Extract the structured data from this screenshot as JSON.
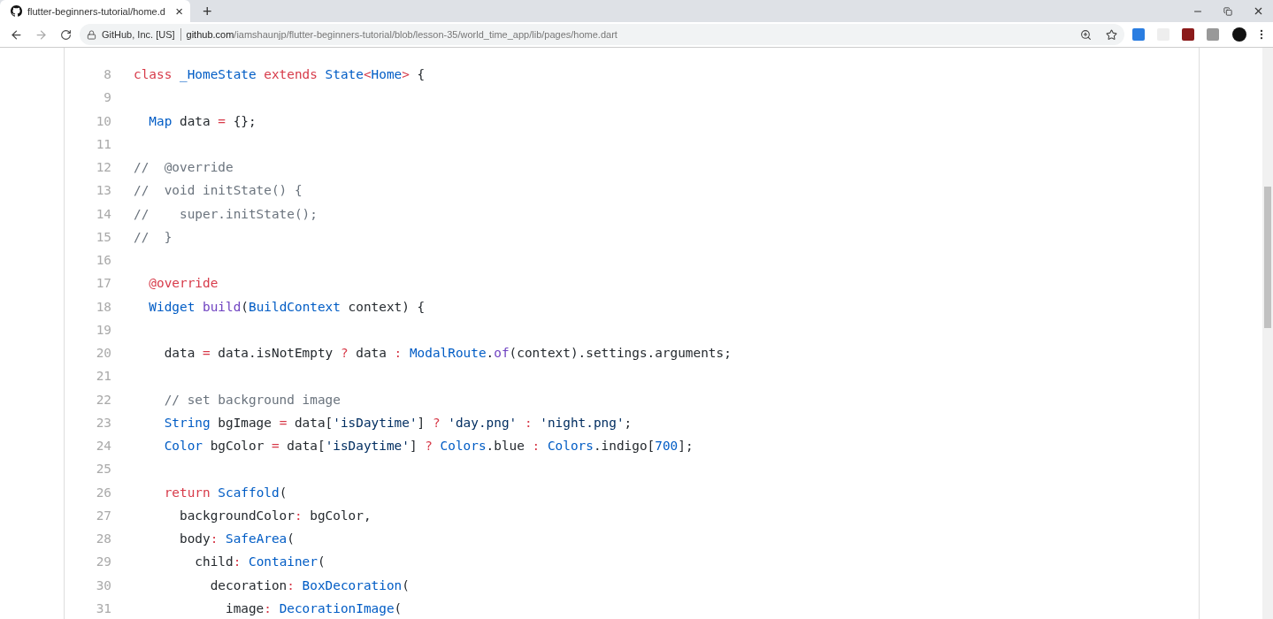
{
  "tab": {
    "title": "flutter-beginners-tutorial/home.d",
    "close": "×",
    "new_tab": "+"
  },
  "address_bar": {
    "site_identity": "GitHub, Inc. [US]",
    "url_host": "github.com",
    "url_path": "/iamshaunjp/flutter-beginners-tutorial/blob/lesson-35/world_time_app/lib/pages/home.dart"
  },
  "code": [
    {
      "number": "8",
      "tokens": [
        {
          "kind": "kw",
          "t": "class"
        },
        {
          "kind": "type",
          "t": " _HomeState "
        },
        {
          "kind": "kw",
          "t": "extends"
        },
        {
          "kind": "type",
          "t": " State"
        },
        {
          "kind": "op",
          "t": "<"
        },
        {
          "kind": "type",
          "t": "Home"
        },
        {
          "kind": "op",
          "t": ">"
        },
        {
          "kind": "plain",
          "t": " {"
        }
      ]
    },
    {
      "number": "9"
    },
    {
      "number": "10",
      "tokens": [
        {
          "kind": "type",
          "t": "  Map"
        },
        {
          "kind": "plain",
          "t": " data "
        },
        {
          "kind": "op",
          "t": "="
        },
        {
          "kind": "plain",
          "t": " {};"
        }
      ]
    },
    {
      "number": "11"
    },
    {
      "number": "12",
      "tokens": [
        {
          "kind": "com",
          "t": "//  @override"
        }
      ]
    },
    {
      "number": "13",
      "tokens": [
        {
          "kind": "com",
          "t": "//  void initState() {"
        }
      ]
    },
    {
      "number": "14",
      "tokens": [
        {
          "kind": "com",
          "t": "//    super.initState();"
        }
      ]
    },
    {
      "number": "15",
      "tokens": [
        {
          "kind": "com",
          "t": "//  }"
        }
      ]
    },
    {
      "number": "16"
    },
    {
      "number": "17",
      "tokens": [
        {
          "kind": "kw",
          "t": "  @override"
        }
      ]
    },
    {
      "number": "18",
      "tokens": [
        {
          "kind": "type",
          "t": "  Widget "
        },
        {
          "kind": "fn",
          "t": "build"
        },
        {
          "kind": "plain",
          "t": "("
        },
        {
          "kind": "type",
          "t": "BuildContext"
        },
        {
          "kind": "plain",
          "t": " context) {"
        }
      ]
    },
    {
      "number": "19"
    },
    {
      "number": "20",
      "tokens": [
        {
          "kind": "plain",
          "t": "    data "
        },
        {
          "kind": "op",
          "t": "="
        },
        {
          "kind": "plain",
          "t": " data.isNotEmpty "
        },
        {
          "kind": "op",
          "t": "?"
        },
        {
          "kind": "plain",
          "t": " data "
        },
        {
          "kind": "op",
          "t": ":"
        },
        {
          "kind": "type",
          "t": " ModalRoute"
        },
        {
          "kind": "plain",
          "t": "."
        },
        {
          "kind": "fn",
          "t": "of"
        },
        {
          "kind": "plain",
          "t": "(context).settings.arguments;"
        }
      ]
    },
    {
      "number": "21"
    },
    {
      "number": "22",
      "tokens": [
        {
          "kind": "com",
          "t": "    // set background image"
        }
      ]
    },
    {
      "number": "23",
      "tokens": [
        {
          "kind": "type",
          "t": "    String"
        },
        {
          "kind": "plain",
          "t": " bgImage "
        },
        {
          "kind": "op",
          "t": "="
        },
        {
          "kind": "plain",
          "t": " data["
        },
        {
          "kind": "str",
          "t": "'isDaytime'"
        },
        {
          "kind": "plain",
          "t": "] "
        },
        {
          "kind": "op",
          "t": "?"
        },
        {
          "kind": "str",
          "t": " 'day.png' "
        },
        {
          "kind": "op",
          "t": ":"
        },
        {
          "kind": "str",
          "t": " 'night.png'"
        },
        {
          "kind": "plain",
          "t": ";"
        }
      ]
    },
    {
      "number": "24",
      "tokens": [
        {
          "kind": "type",
          "t": "    Color"
        },
        {
          "kind": "plain",
          "t": " bgColor "
        },
        {
          "kind": "op",
          "t": "="
        },
        {
          "kind": "plain",
          "t": " data["
        },
        {
          "kind": "str",
          "t": "'isDaytime'"
        },
        {
          "kind": "plain",
          "t": "] "
        },
        {
          "kind": "op",
          "t": "?"
        },
        {
          "kind": "type",
          "t": " Colors"
        },
        {
          "kind": "plain",
          "t": ".blue "
        },
        {
          "kind": "op",
          "t": ":"
        },
        {
          "kind": "type",
          "t": " Colors"
        },
        {
          "kind": "plain",
          "t": ".indigo["
        },
        {
          "kind": "num",
          "t": "700"
        },
        {
          "kind": "plain",
          "t": "];"
        }
      ]
    },
    {
      "number": "25"
    },
    {
      "number": "26",
      "tokens": [
        {
          "kind": "kw",
          "t": "    return "
        },
        {
          "kind": "type",
          "t": "Scaffold"
        },
        {
          "kind": "plain",
          "t": "("
        }
      ]
    },
    {
      "number": "27",
      "tokens": [
        {
          "kind": "plain",
          "t": "      backgroundColor"
        },
        {
          "kind": "op",
          "t": ":"
        },
        {
          "kind": "plain",
          "t": " bgColor,"
        }
      ]
    },
    {
      "number": "28",
      "tokens": [
        {
          "kind": "plain",
          "t": "      body"
        },
        {
          "kind": "op",
          "t": ":"
        },
        {
          "kind": "type",
          "t": " SafeArea"
        },
        {
          "kind": "plain",
          "t": "("
        }
      ]
    },
    {
      "number": "29",
      "tokens": [
        {
          "kind": "plain",
          "t": "        child"
        },
        {
          "kind": "op",
          "t": ":"
        },
        {
          "kind": "type",
          "t": " Container"
        },
        {
          "kind": "plain",
          "t": "("
        }
      ]
    },
    {
      "number": "30",
      "tokens": [
        {
          "kind": "plain",
          "t": "          decoration"
        },
        {
          "kind": "op",
          "t": ":"
        },
        {
          "kind": "type",
          "t": " BoxDecoration"
        },
        {
          "kind": "plain",
          "t": "("
        }
      ]
    },
    {
      "number": "31",
      "tokens": [
        {
          "kind": "plain",
          "t": "            image"
        },
        {
          "kind": "op",
          "t": ":"
        },
        {
          "kind": "type",
          "t": " DecorationImage"
        },
        {
          "kind": "plain",
          "t": "("
        }
      ]
    }
  ]
}
